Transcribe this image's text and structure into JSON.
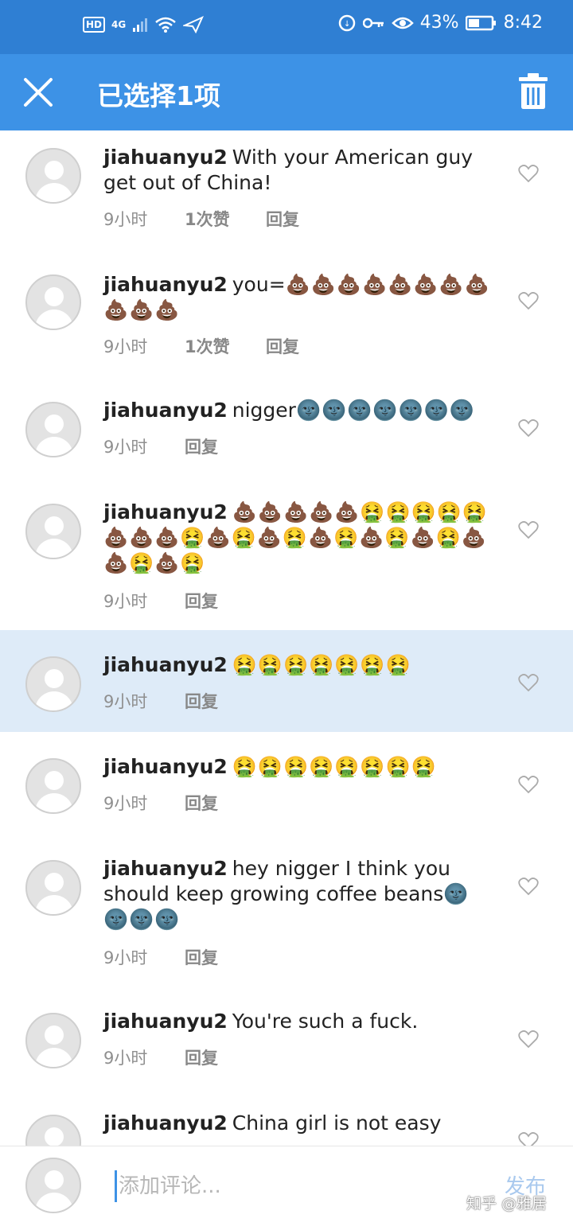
{
  "status_bar": {
    "hd": "HD",
    "signal": "4G",
    "battery_percent": "43%",
    "time": "8:42"
  },
  "header": {
    "title": "已选择1项"
  },
  "comments": [
    {
      "user": "jiahuanyu2",
      "text": "With your American guy get out of China!",
      "emoji": "",
      "time": "9小时",
      "likes": "1次赞",
      "reply": "回复"
    },
    {
      "user": "jiahuanyu2",
      "text": "you=",
      "emoji": "💩💩💩💩💩💩💩💩💩💩💩",
      "time": "9小时",
      "likes": "1次赞",
      "reply": "回复"
    },
    {
      "user": "jiahuanyu2",
      "text": "nigger",
      "emoji": "🌚🌚🌚🌚🌚🌚🌚",
      "time": "9小时",
      "likes": "",
      "reply": "回复"
    },
    {
      "user": "jiahuanyu2",
      "text": "",
      "emoji": "💩💩💩💩💩🤮🤮🤮🤮🤮💩💩💩🤮💩🤮💩🤮💩🤮💩🤮💩🤮💩💩🤮💩🤮",
      "time": "9小时",
      "likes": "",
      "reply": "回复"
    },
    {
      "user": "jiahuanyu2",
      "text": "",
      "emoji": "🤮🤮🤮🤮🤮🤮🤮",
      "time": "9小时",
      "likes": "",
      "reply": "回复"
    },
    {
      "user": "jiahuanyu2",
      "text": "",
      "emoji": "🤮🤮🤮🤮🤮🤮🤮🤮",
      "time": "9小时",
      "likes": "",
      "reply": "回复"
    },
    {
      "user": "jiahuanyu2",
      "text": "hey  nigger I think you should keep growing coffee beans",
      "emoji": "🌚🌚🌚🌚",
      "time": "9小时",
      "likes": "",
      "reply": "回复"
    },
    {
      "user": "jiahuanyu2",
      "text": "You're such a fuck.",
      "emoji": "",
      "time": "9小时",
      "likes": "",
      "reply": "回复"
    },
    {
      "user": "jiahuanyu2",
      "text": "China girl is not easy",
      "emoji": "",
      "time": "",
      "likes": "",
      "reply": ""
    }
  ],
  "comment_input": {
    "placeholder": "添加评论...",
    "publish_label": "发布"
  },
  "watermark": "知乎 @雅居",
  "colors": {
    "status_bar_bg": "#2f7fd3",
    "header_bg": "#3d92e6",
    "selected_row_bg": "#deebf8"
  }
}
